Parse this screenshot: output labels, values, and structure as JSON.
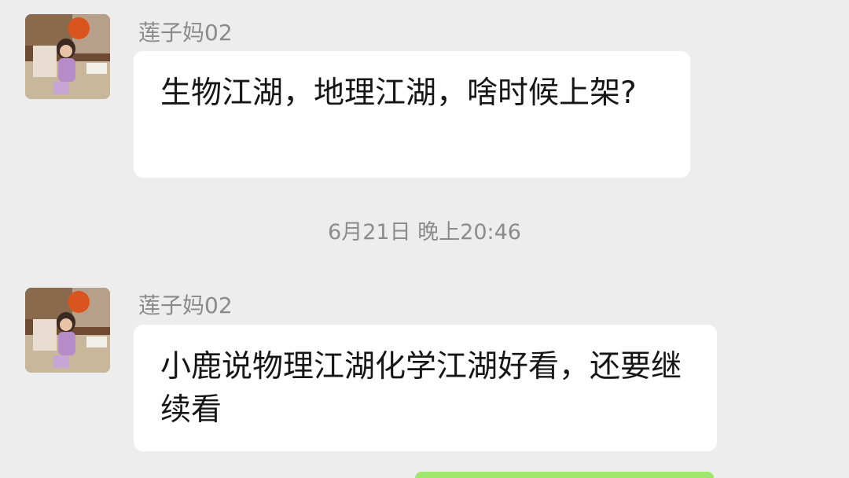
{
  "messages": [
    {
      "sender": "莲子妈02",
      "text": "生物江湖，地理江湖，啥时候上架?"
    },
    {
      "sender": "莲子妈02",
      "text": "小鹿说物理江湖化学江湖好看，还要继续看"
    }
  ],
  "timestamp": "6月21日 晚上20:46",
  "colors": {
    "background": "#ededed",
    "bubble": "#ffffff",
    "sender_name": "#8a8a8a",
    "timestamp": "#8c8c8c",
    "outgoing_bubble": "#9fe870"
  }
}
